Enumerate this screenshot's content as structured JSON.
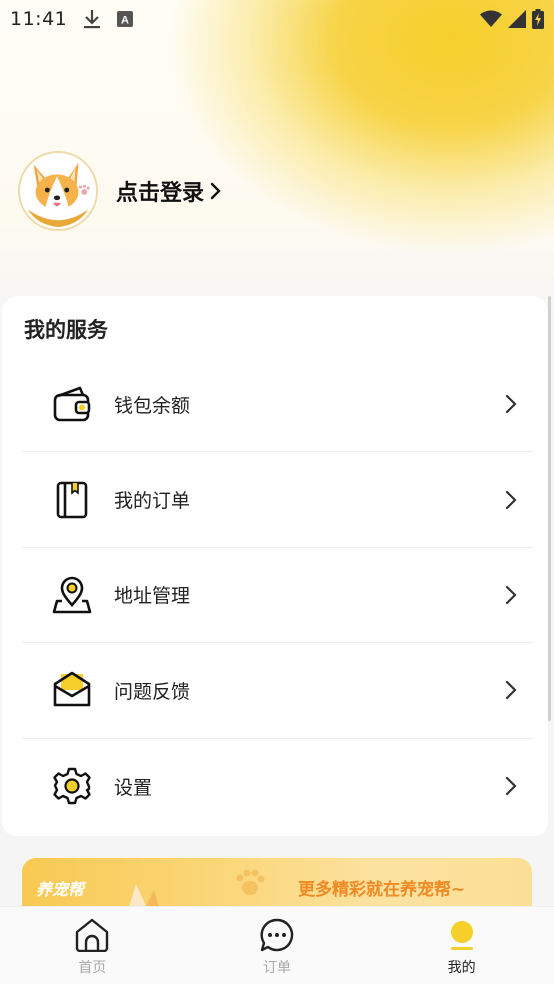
{
  "status_bar": {
    "time": "11:41",
    "icons": [
      "download-icon",
      "keyboard-a-icon",
      "wifi-icon",
      "signal-icon",
      "battery-charging-icon"
    ]
  },
  "profile": {
    "login_label": "点击登录",
    "avatar_icon": "corgi-avatar"
  },
  "services": {
    "title": "我的服务",
    "items": [
      {
        "label": "钱包余额",
        "icon": "wallet-icon"
      },
      {
        "label": "我的订单",
        "icon": "order-book-icon"
      },
      {
        "label": "地址管理",
        "icon": "location-pin-icon"
      },
      {
        "label": "问题反馈",
        "icon": "feedback-mail-icon"
      },
      {
        "label": "设置",
        "icon": "settings-gear-icon"
      }
    ]
  },
  "banner": {
    "brand": "养宠帮",
    "text": "更多精彩就在养宠帮~"
  },
  "tabbar": {
    "tabs": [
      {
        "label": "首页",
        "icon": "home-icon",
        "active": false
      },
      {
        "label": "订单",
        "icon": "chat-bubble-icon",
        "active": false
      },
      {
        "label": "我的",
        "icon": "profile-dot-icon",
        "active": true
      }
    ]
  },
  "colors": {
    "accent": "#f6cf2a",
    "banner_text": "#f08a25",
    "tab_inactive": "#aaaaaa",
    "tab_active": "#222222"
  }
}
